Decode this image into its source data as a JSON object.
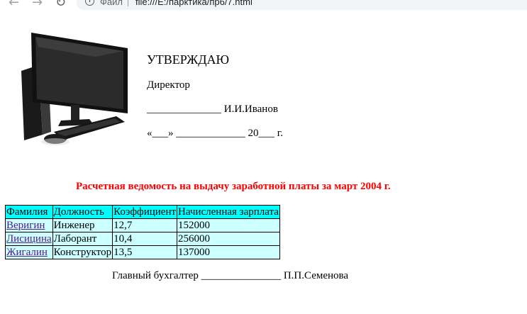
{
  "browser": {
    "scheme_label": "Файл",
    "url": "file:///E:/парктика/пр6/7.html"
  },
  "approval": {
    "title": "УТВЕРЖДАЮ",
    "role": "Директор",
    "signature_line": "______________ И.И.Иванов",
    "date_line": "«___» _____________ 20___ г."
  },
  "document": {
    "title": "Расчетная ведомость на выдачу заработной платы за март 2004 г.",
    "title_color": "#ff0000"
  },
  "table": {
    "headers": [
      "Фамилия",
      "Должность",
      "Коэффициент",
      "Начисленная зарплата"
    ],
    "rows": [
      [
        "Веригин",
        "Инженер",
        "12,7",
        "152000"
      ],
      [
        "Лисицина",
        "Лаборант",
        "10,4",
        "256000"
      ],
      [
        "Жигалин",
        "Конструктор",
        "13,5",
        "137000"
      ]
    ],
    "header_bg": "#00ffff",
    "cell_bg": "#ccffff"
  },
  "footer": {
    "signature": "Главный бухгалтер _______________ П.П.Семенова"
  }
}
